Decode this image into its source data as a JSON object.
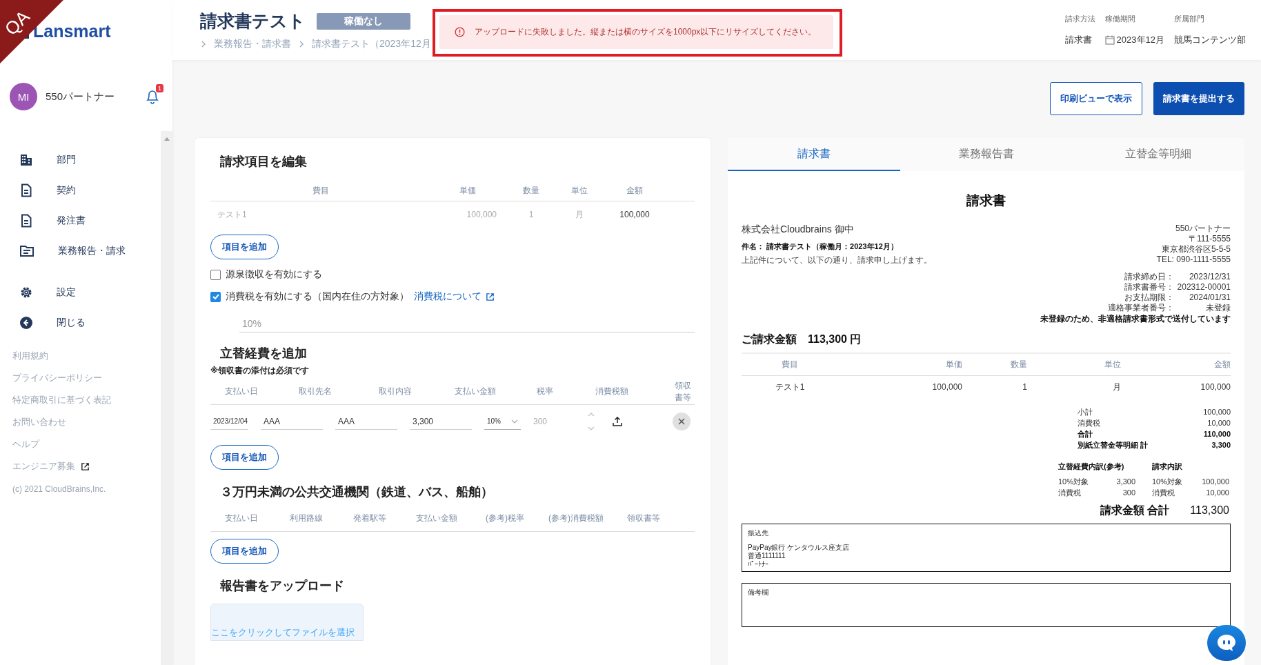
{
  "ribbon": {
    "text": "QA"
  },
  "logo": {
    "text": "Lansmart"
  },
  "user": {
    "initials": "MI",
    "name": "550パートナー",
    "notifications": "1"
  },
  "nav": [
    {
      "label": "部門"
    },
    {
      "label": "契約"
    },
    {
      "label": "発注書"
    },
    {
      "label": "業務報告・請求"
    }
  ],
  "nav_secondary": [
    {
      "label": "設定"
    },
    {
      "label": "閉じる"
    }
  ],
  "footer_links": [
    {
      "label": "利用規約",
      "external": false
    },
    {
      "label": "プライバシーポリシー",
      "external": false
    },
    {
      "label": "特定商取引に基づく表記",
      "external": false
    },
    {
      "label": "お問い合わせ",
      "external": false
    },
    {
      "label": "ヘルプ",
      "external": false
    },
    {
      "label": "エンジニア募集",
      "external": true
    }
  ],
  "copyright": "(c) 2021 CloudBrains,Inc.",
  "header": {
    "title": "請求書テスト",
    "status": "稼働なし",
    "breadcrumbs": [
      "業務報告・請求書",
      "請求書テスト（2023年12月"
    ],
    "meta": [
      {
        "label": "請求方法",
        "value": "請求書"
      },
      {
        "label": "稼働期間",
        "value": "2023年12月"
      },
      {
        "label": "所属部門",
        "value": "競馬コンテンツ部"
      }
    ]
  },
  "toast": {
    "message": "アップロードに失敗しました。縦または横のサイズを1000px以下にリサイズしてください。"
  },
  "actions": [
    {
      "label": "印刷ビューで表示",
      "kind": "outline"
    },
    {
      "label": "請求書を提出する",
      "kind": "primary"
    }
  ],
  "edit": {
    "title": "請求項目を編集",
    "columns": [
      "費目",
      "単価",
      "数量",
      "単位",
      "金額"
    ],
    "rows": [
      [
        "テスト1",
        "100,000",
        "1",
        "月",
        "100,000"
      ]
    ],
    "add_button": "項目を追加",
    "options": [
      {
        "label": "源泉徴収を有効にする",
        "checked": false
      },
      {
        "label": "消費税を有効にする（国内在住の方対象）",
        "checked": true,
        "link": "消費税について"
      }
    ],
    "tax_rate": {
      "placeholder": "10%"
    }
  },
  "expenses": {
    "title": "立替経費を追加",
    "note": "※領収書の添付は必須です",
    "columns": [
      "支払い日",
      "取引先名",
      "取引内容",
      "支払い金額",
      "税率",
      "消費税額",
      "領収書等"
    ],
    "rows": [
      {
        "date": "2023/12/04",
        "payee": "AAA",
        "description": "AAA",
        "amount": "3,300",
        "tax_rate": "10%",
        "tax": "300"
      }
    ],
    "add_button": "項目を追加"
  },
  "transit": {
    "title": "３万円未満の公共交通機関（鉄道、バス、船舶）",
    "columns": [
      "支払い日",
      "利用路線",
      "発着駅等",
      "支払い金額",
      "(参考)税率",
      "(参考)消費税額",
      "領収書等"
    ],
    "add_button": "項目を追加"
  },
  "upload": {
    "title": "報告書をアップロード",
    "dropzone": "ここをクリックしてファイルを選択"
  },
  "preview": {
    "tabs": [
      {
        "label": "請求書",
        "selected": true
      },
      {
        "label": "業務報告書",
        "selected": false
      },
      {
        "label": "立替金等明細",
        "selected": false
      }
    ],
    "invoice": {
      "title": "請求書",
      "recipient": "株式会社Cloudbrains 御中",
      "subject": "件名： 請求書テスト（稼働月：2023年12月）",
      "intro": "上記件について、以下の通り、請求申し上げます。",
      "issuer": [
        "550パートナー",
        "〒111-5555",
        "東京都渋谷区5-5-5",
        "TEL: 090-1111-5555"
      ],
      "details": [
        {
          "label": "請求締め日：",
          "value": "2023/12/31"
        },
        {
          "label": "請求書番号：",
          "value": "202312-00001"
        },
        {
          "label": "お支払期限：",
          "value": "2024/01/31"
        },
        {
          "label": "適格事業者番号：",
          "value": "未登録"
        }
      ],
      "notice": "未登録のため、非適格請求書形式で送付しています",
      "amount_label": "ご請求金額",
      "amount": "113,300 円",
      "columns": [
        "費目",
        "単価",
        "数量",
        "単位",
        "金額"
      ],
      "rows": [
        [
          "テスト1",
          "100,000",
          "1",
          "月",
          "100,000"
        ]
      ],
      "summary": [
        {
          "label": "小計",
          "value": "100,000",
          "bold": false
        },
        {
          "label": "消費税",
          "value": "10,000",
          "bold": false
        },
        {
          "label": "合計",
          "value": "110,000",
          "bold": true
        },
        {
          "label": "別紙立替金等明細 計",
          "value": "3,300",
          "bold": true
        }
      ],
      "breakdowns": [
        {
          "title": "立替経費内訳(参考)",
          "rows": [
            {
              "label": "10%対象",
              "value": "3,300"
            },
            {
              "label": "消費税",
              "value": "300"
            }
          ]
        },
        {
          "title": "請求内訳",
          "rows": [
            {
              "label": "10%対象",
              "value": "100,000"
            },
            {
              "label": "消費税",
              "value": "10,000"
            }
          ]
        }
      ],
      "total_label": "請求金額 合計",
      "total": "113,300",
      "bank": {
        "label": "振込先",
        "lines": [
          "PayPay銀行 ケンタウルス座支店",
          "普通1111111",
          "ﾊﾟｰﾄﾅｰ"
        ]
      },
      "remarks": {
        "label": "備考欄"
      }
    }
  }
}
